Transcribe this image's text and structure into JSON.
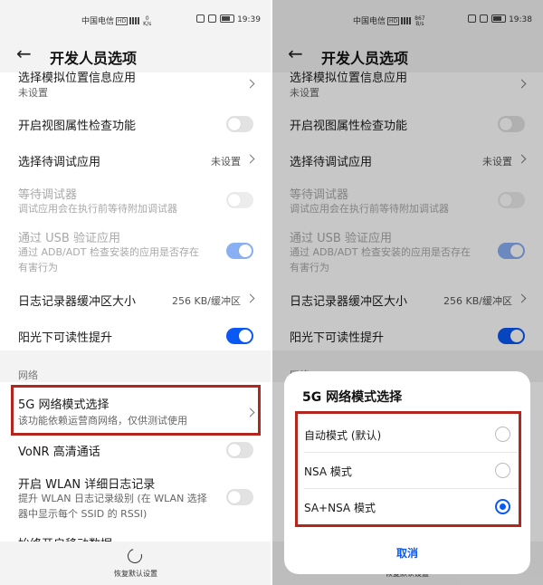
{
  "left": {
    "status": {
      "carrier": "中国电信",
      "hd": "HD",
      "speed_top": "0",
      "speed_unit": "K/s",
      "time": "19:39"
    },
    "header": {
      "title": "开发人员选项"
    },
    "rows": {
      "mock_location": {
        "title": "选择模拟位置信息应用",
        "subtitle": "未设置"
      },
      "view_attr": {
        "title": "开启视图属性检查功能"
      },
      "debug_app": {
        "title": "选择待调试应用",
        "value": "未设置"
      },
      "wait_debugger": {
        "title": "等待调试器",
        "subtitle": "调试应用会在执行前等待附加调试器"
      },
      "usb_verify": {
        "title": "通过 USB 验证应用",
        "subtitle_1": "通过 ADB/ADT 检查安装的应用是否存在",
        "subtitle_2": "有害行为"
      },
      "log_buffer": {
        "title": "日志记录器缓冲区大小",
        "value": "256 KB/缓冲区"
      },
      "sunlight": {
        "title": "阳光下可读性提升"
      }
    },
    "section_network": "网络",
    "network_rows": {
      "mode_5g": {
        "title": "5G 网络模式选择",
        "subtitle": "该功能依赖运营商网络，仅供测试使用"
      },
      "vonr": {
        "title": "VoNR 高清通话"
      },
      "wlan_log": {
        "title": "开启 WLAN 详细日志记录",
        "subtitle_1": "提升 WLAN 日志记录级别 (在 WLAN 选择",
        "subtitle_2": "器中显示每个 SSID 的 RSSI)"
      },
      "mobile_data": {
        "title": "始终开启移动数据"
      }
    },
    "bottom": {
      "reset_label": "恢复默认设置"
    }
  },
  "right": {
    "status": {
      "carrier": "中国电信",
      "hd": "HD",
      "speed_top": "867",
      "speed_unit": "B/s",
      "time": "19:38"
    },
    "header": {
      "title": "开发人员选项"
    },
    "rows": {
      "mock_location": {
        "title": "选择模拟位置信息应用",
        "subtitle": "未设置"
      },
      "view_attr": {
        "title": "开启视图属性检查功能"
      },
      "debug_app": {
        "title": "选择待调试应用",
        "value": "未设置"
      },
      "wait_debugger": {
        "title": "等待调试器",
        "subtitle": "调试应用会在执行前等待附加调试器"
      },
      "usb_verify": {
        "title": "通过 USB 验证应用",
        "subtitle_1": "通过 ADB/ADT 检查安装的应用是否存在",
        "subtitle_2": "有害行为"
      },
      "log_buffer": {
        "title": "日志记录器缓冲区大小",
        "value": "256 KB/缓冲区"
      },
      "sunlight": {
        "title": "阳光下可读性提升"
      }
    },
    "section_network": "网络",
    "bottom": {
      "reset_label": "恢复默认设置"
    },
    "dialog": {
      "title": "5G 网络模式选择",
      "options": [
        {
          "label": "自动模式 (默认)",
          "selected": false
        },
        {
          "label": "NSA 模式",
          "selected": false
        },
        {
          "label": "SA+NSA 模式",
          "selected": true
        }
      ],
      "cancel": "取消"
    }
  },
  "colors": {
    "accent": "#0a59f7",
    "highlight_box": "#b3261e"
  }
}
